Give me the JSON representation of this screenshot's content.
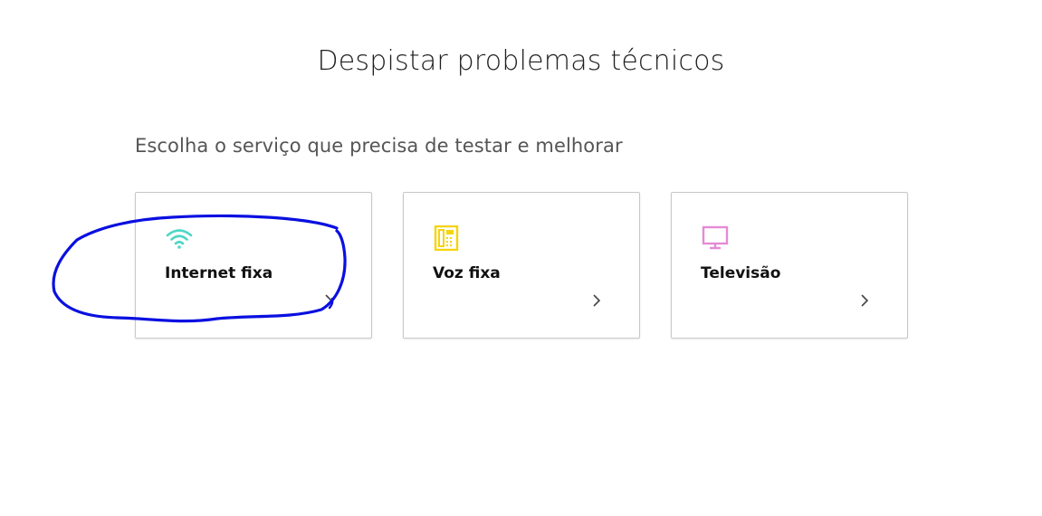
{
  "header": {
    "title": "Despistar problemas técnicos"
  },
  "main": {
    "subtitle": "Escolha o serviço que precisa de testar e melhorar",
    "services": [
      {
        "label": "Internet fixa",
        "icon": "wifi-icon",
        "icon_color": "#4fd6c6"
      },
      {
        "label": "Voz fixa",
        "icon": "phone-icon",
        "icon_color": "#f5d40b"
      },
      {
        "label": "Televisão",
        "icon": "tv-icon",
        "icon_color": "#e58ad6"
      }
    ]
  },
  "annotation": {
    "color": "#0a10e0"
  }
}
